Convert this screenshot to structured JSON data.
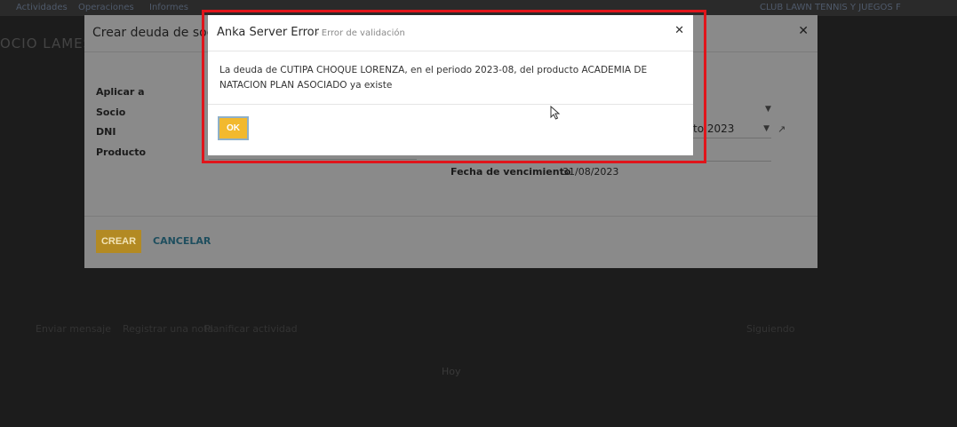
{
  "navbar": {
    "items": [
      "Actividades",
      "Operaciones",
      "Informes"
    ],
    "company": "CLUB LAWN TENNIS Y JUEGOS F"
  },
  "background": {
    "title": "OCIO LAMES",
    "chatter": {
      "send_message": "Enviar mensaje",
      "log_note": "Registrar una nota",
      "schedule_activity": "Planificar actividad",
      "following": "Siguiendo",
      "today": "Hoy"
    }
  },
  "create_debt_modal": {
    "title": "Crear deuda de socio",
    "close_icon": "close-icon",
    "labels": {
      "apply_to": "Aplicar a",
      "member": "Socio",
      "dni": "DNI",
      "product": "Producto",
      "due_date": "Fecha de vencimiento"
    },
    "due_date_value": "31/08/2023",
    "period_select_value": "to 2023",
    "buttons": {
      "create": "CREAR",
      "cancel": "CANCELAR"
    }
  },
  "error_dialog": {
    "title": "Anka Server Error",
    "subtitle": "- Error de validación",
    "message": "La deuda de CUTIPA CHOQUE LORENZA, en el periodo 2023-08, del producto ACADEMIA DE NATACION PLAN ASOCIADO ya existe",
    "ok_label": "OK",
    "close_icon": "close-icon"
  },
  "colors": {
    "highlight": "#e0151b",
    "ok_button": "#f2b92e",
    "create_button": "#b38a23"
  }
}
